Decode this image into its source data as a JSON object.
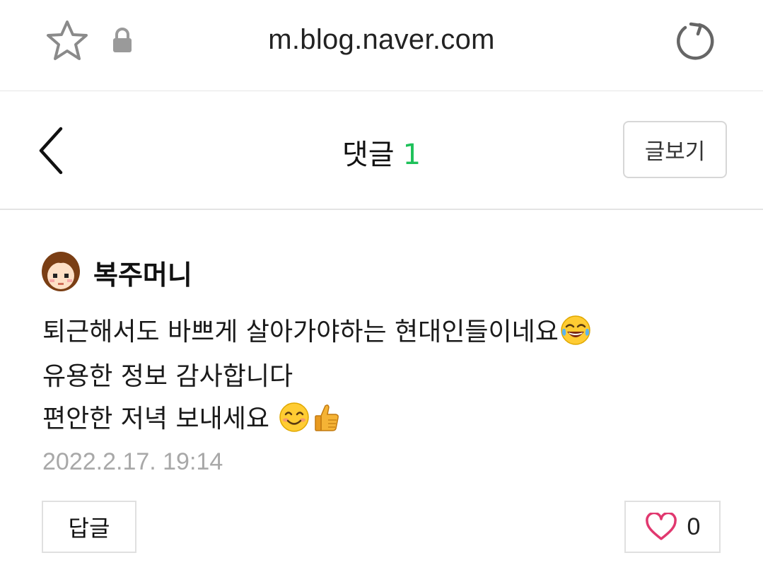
{
  "browser": {
    "url": "m.blog.naver.com",
    "icons": [
      "star-icon",
      "lock-icon",
      "reload-icon"
    ]
  },
  "header": {
    "title": "댓글",
    "count": "1",
    "view_post_label": "글보기",
    "count_color": "#1ec15a"
  },
  "comment": {
    "author": "복주머니",
    "lines": [
      "퇴근해서도 바쁘게 살아가야하는 현대인들이네요",
      "유용한 정보 감사합니다",
      "편안한 저녁 보내세요 "
    ],
    "emojis": [
      "tears-of-joy-emoji",
      "smiling-face-emoji",
      "thumbs-up-emoji"
    ],
    "date": "2022.2.17. 19:14",
    "reply_label": "답글",
    "like_count": "0"
  }
}
